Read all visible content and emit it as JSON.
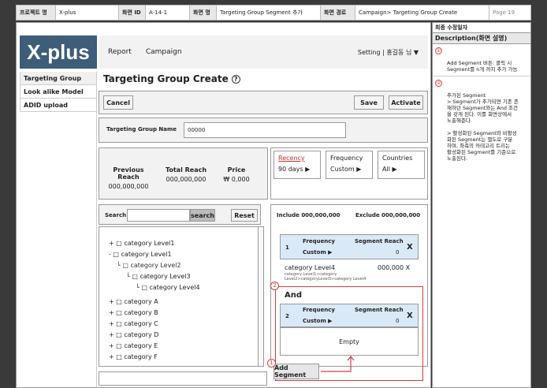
{
  "meta": {
    "project_label": "프로젝트 명",
    "project_value": "X-plus",
    "screen_id_label": "화면 ID",
    "screen_id_value": "A-14-1",
    "screen_name_label": "화면 명",
    "screen_name_value": "Targeting Group Segment 추가",
    "screen_path_label": "화면 경로",
    "screen_path_value": "Campaign> Targeting Group Create",
    "page": "Page 19"
  },
  "logo": "X-plus",
  "nav": {
    "report": "Report",
    "campaign": "Campaign",
    "setting": "Setting | 홍길동 님 ▼"
  },
  "sidebar": {
    "items": [
      {
        "label": "Targeting Group"
      },
      {
        "label": "Look alike Model"
      },
      {
        "label": "ADID upload"
      }
    ]
  },
  "page_title": "Targeting Group Create",
  "help_glyph": "?",
  "buttons": {
    "cancel": "Cancel",
    "save": "Save",
    "activate": "Activate",
    "search": "search",
    "reset": "Reset",
    "add_segment": "Add Segment"
  },
  "tg_name": {
    "label": "Targeting Group Name",
    "value": "00000"
  },
  "stats": {
    "previous_reach_label": "Previous Reach",
    "previous_reach_value": "000,000,000",
    "total_reach_label": "Total Reach",
    "total_reach_value": "000,000,000",
    "price_label": "Price",
    "price_value": "₩ 0,000"
  },
  "filters": {
    "recency_label": "Recency",
    "recency_value": "90 days ▶",
    "frequency_label": "Frequency",
    "frequency_value": "Custom ▶",
    "countries_label": "Countries",
    "countries_value": "All ▶"
  },
  "search": {
    "label": "Search",
    "value": ""
  },
  "tree": [
    "+ □ category Level1",
    "- □ category Level1",
    "└ □ category Level2",
    "└ □ category Level3",
    "└ □ category Level4",
    "+ □ category A",
    "+ □ category B",
    "+ □ category C",
    "+ □ category D",
    "+ □ category E",
    "+ □ category F"
  ],
  "segment_panel": {
    "include": "Include  000,000,000",
    "exclude": "Exclude  000,000,000",
    "seg1": {
      "num": "1",
      "freq_label": "Frequency",
      "freq_value": "Custom ▶",
      "reach_label": "Segment Reach",
      "reach_value": "0",
      "close": "X"
    },
    "cat": {
      "name": "category Level4",
      "value": "000,000  X",
      "path1": "category  Level1>category",
      "path2": "Level2>categoryLevel3>category  Level4"
    },
    "and": "And",
    "seg2": {
      "num": "2",
      "freq_label": "Frequency",
      "freq_value": "Custom ▶",
      "reach_label": "Segment Reach",
      "reach_value": "0",
      "close": "X"
    },
    "empty": "Empty"
  },
  "badges": {
    "one": "1",
    "two": "2"
  },
  "description": {
    "updated": "최종 수정일자",
    "header": "Description(화면 설명)",
    "entries": [
      {
        "num": "①",
        "text": "Add Segment 버튼: 클릭 시\nSegment를 n개 까지 추가 가능"
      },
      {
        "num": "②",
        "text": "추가된 Segment\n> Segment가 추가되면 기존 존\n재하던 Segment와는 And 조건\n을 갖게 된다. 이를 화면상에서\n노출해준다.\n\n> 활성화된 Segment와 비활성\n화된 Segment는 별도로 구분\n하며, 좌측의 카테고리 트리는\n활성화된 Segment를 기준으로\n노출된다."
      }
    ]
  },
  "colors": {
    "logo_bg": "#3d5d78",
    "highlight_red": "#d04040",
    "active_segment": "#d9e9f7"
  }
}
